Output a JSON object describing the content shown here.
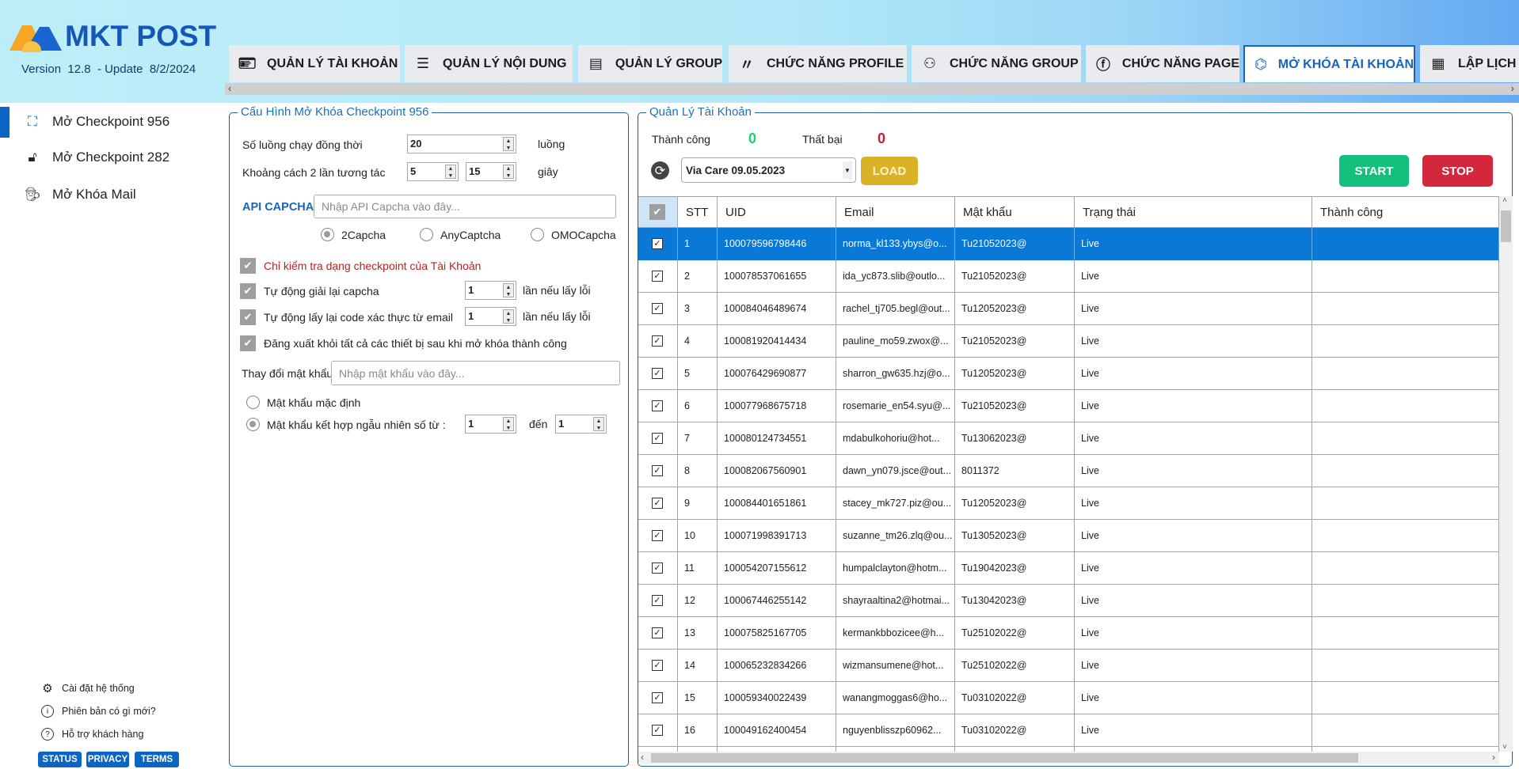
{
  "app": {
    "name": "MKT POST",
    "version_label": "Version",
    "version": "12.8",
    "update_label": "- Update",
    "update_date": "8/2/2024"
  },
  "tabs": [
    {
      "label": "QUẢN LÝ TÀI KHOẢN",
      "icon": "account-card-icon"
    },
    {
      "label": "QUẢN LÝ NỘI DUNG",
      "icon": "list-icon"
    },
    {
      "label": "QUẢN LÝ GROUP",
      "icon": "document-icon"
    },
    {
      "label": "CHỨC NĂNG PROFILE",
      "icon": "profile-icon"
    },
    {
      "label": "CHỨC NĂNG GROUP",
      "icon": "people-icon"
    },
    {
      "label": "CHỨC NĂNG PAGE",
      "icon": "facebook-icon"
    },
    {
      "label": "MỞ KHÓA TÀI KHOẢN",
      "icon": "fingerprint-icon",
      "active": true
    },
    {
      "label": "LẬP LỊCH",
      "icon": "calendar-icon"
    }
  ],
  "sidebar": {
    "items": [
      {
        "label": "Mở Checkpoint 956",
        "icon": "face-scan-icon",
        "selected": true
      },
      {
        "label": "Mở Checkpoint 282",
        "icon": "lock-icon"
      },
      {
        "label": "Mở Khóa Mail",
        "icon": "spy-icon"
      }
    ],
    "footer": [
      {
        "label": "Cài đặt hệ thống",
        "icon": "gear-icon"
      },
      {
        "label": "Phiên bản có gì mới?",
        "icon": "info-icon"
      },
      {
        "label": "Hỗ trợ khách hàng",
        "icon": "help-icon"
      }
    ],
    "buttons": [
      "STATUS",
      "PRIVACY",
      "TERMS"
    ]
  },
  "config": {
    "title": "Cấu Hình Mở Khóa Checkpoint 956",
    "threads_label": "Số luồng chạy đồng thời",
    "threads": "20",
    "threads_unit": "luồng",
    "delay_label": "Khoảng cách 2 lần tương tác",
    "delay_min": "5",
    "delay_max": "15",
    "delay_unit": "giây",
    "api_label": "API CAPCHA",
    "api_placeholder": "Nhập API Capcha vào đây...",
    "captcha_options": [
      "2Capcha",
      "AnyCaptcha",
      "OMOCapcha"
    ],
    "captcha_selected": "2Capcha",
    "check_only": {
      "label": "Chỉ kiểm tra dạng checkpoint của Tài Khoản",
      "checked": true
    },
    "retry_captcha": {
      "label": "Tự động giải lại capcha",
      "checked": true,
      "value": "1",
      "suffix": "lần nếu lấy lỗi"
    },
    "retry_code": {
      "label": "Tự động lấy lại code xác thực từ email",
      "checked": true,
      "value": "1",
      "suffix": "lần nếu lấy lỗi"
    },
    "logout_all": {
      "label": "Đăng xuất khỏi tất cả các thiết bị sau khi mở khóa thành công",
      "checked": true
    },
    "change_pw_label": "Thay đổi mật khẩu",
    "change_pw_placeholder": "Nhập mật khẩu vào đây...",
    "pw_default_label": "Mật khẩu mặc định",
    "pw_random_label": "Mật khẩu kết hợp ngẫu nhiên số từ :",
    "pw_random_from": "1",
    "pw_to_label": "đến",
    "pw_random_to": "1",
    "pw_mode": "random"
  },
  "accounts": {
    "title": "Quản Lý Tài Khoản",
    "success_label": "Thành công",
    "success_count": "0",
    "fail_label": "Thất bại",
    "fail_count": "0",
    "file_selected": "Via Care 09.05.2023",
    "load_label": "LOAD",
    "start_label": "START",
    "stop_label": "STOP",
    "colors": {
      "success": "#18d36b",
      "fail": "#c0203a",
      "load": "#dbb227",
      "start": "#12bf7c",
      "stop": "#d3283c",
      "selected_row": "#0a78d6"
    },
    "columns": [
      "STT",
      "UID",
      "Email",
      "Mật khẩu",
      "Trạng thái",
      "Thành công"
    ],
    "rows": [
      [
        "1",
        "100079596798446",
        "norma_kl133.ybys@o...",
        "Tu21052023@",
        "Live",
        ""
      ],
      [
        "2",
        "100078537061655",
        "ida_yc873.slib@outlo...",
        "Tu21052023@",
        "Live",
        ""
      ],
      [
        "3",
        "100084046489674",
        "rachel_tj705.begl@out...",
        "Tu12052023@",
        "Live",
        ""
      ],
      [
        "4",
        "100081920414434",
        "pauline_mo59.zwox@...",
        "Tu21052023@",
        "Live",
        ""
      ],
      [
        "5",
        "100076429690877",
        "sharron_gw635.hzj@o...",
        "Tu12052023@",
        "Live",
        ""
      ],
      [
        "6",
        "100077968675718",
        "rosemarie_en54.syu@...",
        "Tu21052023@",
        "Live",
        ""
      ],
      [
        "7",
        "100080124734551",
        "mdabulkohoriu@hot...",
        "Tu13062023@",
        "Live",
        ""
      ],
      [
        "8",
        "100082067560901",
        "dawn_yn079.jsce@out...",
        "8011372",
        "Live",
        ""
      ],
      [
        "9",
        "100084401651861",
        "stacey_mk727.piz@ou...",
        "Tu12052023@",
        "Live",
        ""
      ],
      [
        "10",
        "100071998391713",
        "suzanne_tm26.zlq@ou...",
        "Tu13052023@",
        "Live",
        ""
      ],
      [
        "11",
        "100054207155612",
        "humpalclayton@hotm...",
        "Tu19042023@",
        "Live",
        ""
      ],
      [
        "12",
        "100067446255142",
        "shayraaltina2@hotmai...",
        "Tu13042023@",
        "Live",
        ""
      ],
      [
        "13",
        "100075825167705",
        "kermankbbozicee@h...",
        "Tu25102022@",
        "Live",
        ""
      ],
      [
        "14",
        "100065232834266",
        "wizmansumene@hot...",
        "Tu25102022@",
        "Live",
        ""
      ],
      [
        "15",
        "100059340022439",
        "wanangmoggas6@ho...",
        "Tu03102022@",
        "Live",
        ""
      ],
      [
        "16",
        "100049162400454",
        "nguyenblisszp60962...",
        "Tu03102022@",
        "Live",
        ""
      ]
    ],
    "selected_row": 0
  }
}
